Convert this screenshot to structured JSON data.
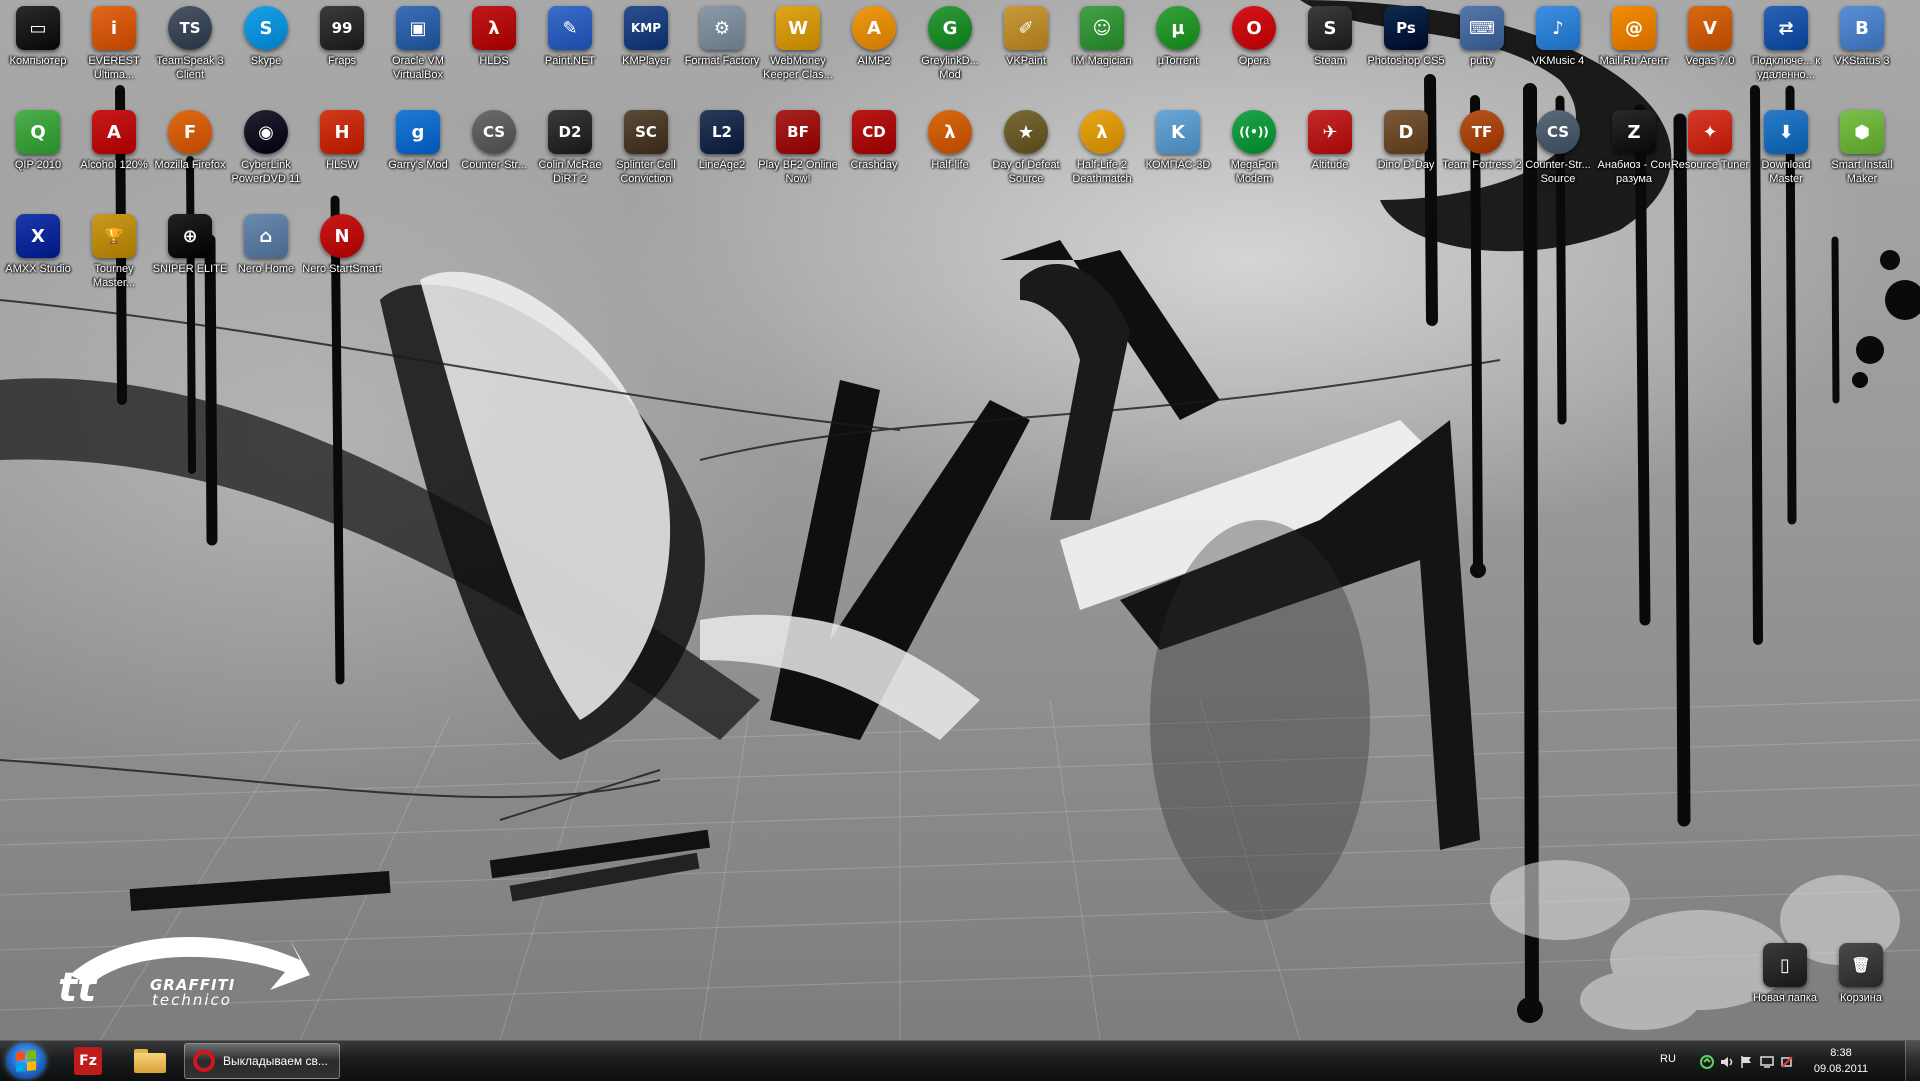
{
  "desktop": {
    "icons": [
      {
        "id": "computer",
        "label": "Компьютер",
        "icon": "computer-monitor-icon",
        "color": "#2a2a2a",
        "glyph": "▭"
      },
      {
        "id": "everest",
        "label": "EVEREST Ultima...",
        "icon": "everest-info-icon",
        "color": "#e0671b",
        "glyph": "i"
      },
      {
        "id": "teamspeak",
        "label": "TeamSpeak 3 Client",
        "icon": "teamspeak-icon",
        "color": "#4a5566",
        "glyph": "TS"
      },
      {
        "id": "skype",
        "label": "Skype",
        "icon": "skype-icon",
        "color": "#1aa0e8",
        "glyph": "S"
      },
      {
        "id": "fraps",
        "label": "Fraps",
        "icon": "fraps-icon",
        "color": "#3b3b3b",
        "glyph": "99"
      },
      {
        "id": "virtualbox",
        "label": "Oracle VM VirtualBox",
        "icon": "virtualbox-icon",
        "color": "#3d6fb5",
        "glyph": "▣"
      },
      {
        "id": "hlds",
        "label": "HLDS",
        "icon": "hlds-lambda-icon",
        "color": "#c0181a",
        "glyph": "λ"
      },
      {
        "id": "paintnet",
        "label": "Paint.NET",
        "icon": "paintnet-icon",
        "color": "#3b6dc9",
        "glyph": "✎"
      },
      {
        "id": "kmplayer",
        "label": "KMPlayer",
        "icon": "kmplayer-icon",
        "color": "#2c4f8d",
        "glyph": "KMP"
      },
      {
        "id": "formatfactory",
        "label": "Format Factory",
        "icon": "format-factory-icon",
        "color": "#8a9aa8",
        "glyph": "⚙"
      },
      {
        "id": "webmoney",
        "label": "WebMoney Keeper Clas...",
        "icon": "webmoney-icon",
        "color": "#e0a51c",
        "glyph": "W"
      },
      {
        "id": "aimp2",
        "label": "AIMP2",
        "icon": "aimp-icon",
        "color": "#f09a14",
        "glyph": "A"
      },
      {
        "id": "greylink",
        "label": "GreylinkD... Mod",
        "icon": "greylink-icon",
        "color": "#2e9a3a",
        "glyph": "G"
      },
      {
        "id": "vkpaint",
        "label": "VKPaint",
        "icon": "vkpaint-icon",
        "color": "#c99a3c",
        "glyph": "✐"
      },
      {
        "id": "immagician",
        "label": "IM Magician",
        "icon": "im-magician-icon",
        "color": "#45a148",
        "glyph": "☺"
      },
      {
        "id": "utorrent",
        "label": "µTorrent",
        "icon": "utorrent-icon",
        "color": "#35a23b",
        "glyph": "µ"
      },
      {
        "id": "opera",
        "label": "Opera",
        "icon": "opera-icon",
        "color": "#d5151d",
        "glyph": "O"
      },
      {
        "id": "steam",
        "label": "Steam",
        "icon": "steam-icon",
        "color": "#3c3c3c",
        "glyph": "S"
      },
      {
        "id": "photoshop",
        "label": "Photoshop CS5",
        "icon": "photoshop-icon",
        "color": "#0d2b4d",
        "glyph": "Ps"
      },
      {
        "id": "putty",
        "label": "putty",
        "icon": "putty-icon",
        "color": "#5577aa",
        "glyph": "⌨"
      },
      {
        "id": "vkmusic",
        "label": "VKMusic 4",
        "icon": "vkmusic-icon",
        "color": "#3f8fe0",
        "glyph": "♪"
      },
      {
        "id": "mailru",
        "label": "Mail.Ru Агент",
        "icon": "mailru-agent-icon",
        "color": "#f28d00",
        "glyph": "@"
      },
      {
        "id": "vegas",
        "label": "Vegas 7.0",
        "icon": "vegas-icon",
        "color": "#d86a13",
        "glyph": "V"
      },
      {
        "id": "rdp",
        "label": "Подключе... к удаленно...",
        "icon": "remote-desktop-icon",
        "color": "#2a62b5",
        "glyph": "⇄"
      },
      {
        "id": "vkstatus",
        "label": "VKStatus 3",
        "icon": "vkstatus-icon",
        "color": "#5a8fd6",
        "glyph": "B"
      },
      {
        "id": "qip",
        "label": "QIP 2010",
        "icon": "qip-icon",
        "color": "#4bb04b",
        "glyph": "Q"
      },
      {
        "id": "alcohol",
        "label": "Alcohol 120%",
        "icon": "alcohol-icon",
        "color": "#c81a1a",
        "glyph": "A"
      },
      {
        "id": "firefox",
        "label": "Mozilla Firefox",
        "icon": "firefox-icon",
        "color": "#e06b14",
        "glyph": "F"
      },
      {
        "id": "powerdvd",
        "label": "CyberLink PowerDVD 11",
        "icon": "powerdvd-icon",
        "color": "#222233",
        "glyph": "◉"
      },
      {
        "id": "hlsw",
        "label": "HLSW",
        "icon": "hlsw-icon",
        "color": "#d23a1b",
        "glyph": "H"
      },
      {
        "id": "garrysmod",
        "label": "Garry's Mod",
        "icon": "garrys-mod-icon",
        "color": "#1f7ad6",
        "glyph": "g"
      },
      {
        "id": "counterstrike",
        "label": "Counter-Str...",
        "icon": "counter-strike-icon",
        "color": "#6b6b6b",
        "glyph": "CS"
      },
      {
        "id": "dirt2",
        "label": "Colin McRae DiRT 2",
        "icon": "dirt2-icon",
        "color": "#3a3a3a",
        "glyph": "D2"
      },
      {
        "id": "splintercell",
        "label": "Splinter Cell Conviction",
        "icon": "splinter-cell-icon",
        "color": "#5a4a3a",
        "glyph": "SC"
      },
      {
        "id": "lineage2",
        "label": "LineAge2",
        "icon": "lineage2-icon",
        "color": "#2a3a5a",
        "glyph": "L2"
      },
      {
        "id": "battlefield",
        "label": "Play BF2 Online Now!",
        "icon": "battlefield-icon",
        "color": "#aa2222",
        "glyph": "BF"
      },
      {
        "id": "crashday",
        "label": "Crashday",
        "icon": "crashday-icon",
        "color": "#b81818",
        "glyph": "CD"
      },
      {
        "id": "halflife",
        "label": "Half-life",
        "icon": "half-life-icon",
        "color": "#d96a10",
        "glyph": "λ"
      },
      {
        "id": "dods",
        "label": "Day of Defeat Source",
        "icon": "day-of-defeat-icon",
        "color": "#7a6a3a",
        "glyph": "★"
      },
      {
        "id": "hl2dm",
        "label": "Half-Life 2 Deathmatch",
        "icon": "hl2-deathmatch-icon",
        "color": "#e8a617",
        "glyph": "λ"
      },
      {
        "id": "kompas",
        "label": "КОМПАС-3D",
        "icon": "kompas-3d-icon",
        "color": "#6aa6d6",
        "glyph": "K"
      },
      {
        "id": "megafon",
        "label": "MegaFon Modem",
        "icon": "megafon-modem-icon",
        "color": "#1fa54a",
        "glyph": "((•))"
      },
      {
        "id": "altitude",
        "label": "Altitude",
        "icon": "altitude-icon",
        "color": "#c42a2a",
        "glyph": "✈"
      },
      {
        "id": "dinodday",
        "label": "Dino D-Day",
        "icon": "dino-dday-icon",
        "color": "#7a5a3a",
        "glyph": "D"
      },
      {
        "id": "tf2",
        "label": "Team Fortress 2",
        "icon": "team-fortress-icon",
        "color": "#b5541c",
        "glyph": "TF"
      },
      {
        "id": "cssource",
        "label": "Counter-Str... Source",
        "icon": "cs-source-icon",
        "color": "#5a6a7a",
        "glyph": "CS"
      },
      {
        "id": "anabiosis",
        "label": "Анабиоз - Сон разума",
        "icon": "anabiosis-icon",
        "color": "#2a2a2a",
        "glyph": "Z"
      },
      {
        "id": "resourcetuner",
        "label": "Resource Tuner",
        "icon": "resource-tuner-icon",
        "color": "#d83a2a",
        "glyph": "✦"
      },
      {
        "id": "downloadmaster",
        "label": "Download Master",
        "icon": "download-master-icon",
        "color": "#2a7bc8",
        "glyph": "⬇"
      },
      {
        "id": "smartinstall",
        "label": "Smart Install Maker",
        "icon": "smart-install-icon",
        "color": "#7ac04a",
        "glyph": "⬢"
      },
      {
        "id": "amxx",
        "label": "AMXX Studio",
        "icon": "amxx-studio-icon",
        "color": "#1a3aa8",
        "glyph": "X"
      },
      {
        "id": "tourney",
        "label": "Tourney Master...",
        "icon": "trophy-icon",
        "color": "#c99a1c",
        "glyph": "🏆"
      },
      {
        "id": "sniperelite",
        "label": "SNIPER ELITE",
        "icon": "crosshair-icon",
        "color": "#222222",
        "glyph": "⊕"
      },
      {
        "id": "nerohome",
        "label": "Nero Home",
        "icon": "nero-home-icon",
        "color": "#6a8ab0",
        "glyph": "⌂"
      },
      {
        "id": "nerostart",
        "label": "Nero StartSmart",
        "icon": "nero-startsmart-icon",
        "color": "#c81a1a",
        "glyph": "N"
      },
      {
        "id": "newfolder",
        "label": "Новая папка",
        "icon": "folder-icon",
        "color": "#3a3a3a",
        "glyph": "▯"
      },
      {
        "id": "recyclebin",
        "label": "Корзина",
        "icon": "recycle-bin-icon",
        "color": "#4a4a4a",
        "glyph": "🗑"
      }
    ]
  },
  "wallpaper": {
    "logo_line1": "GRAFFITI",
    "logo_line2": "technico",
    "logo_mark": "tt"
  },
  "taskbar": {
    "start_label": "Start",
    "pinned": [
      {
        "id": "filezilla",
        "icon": "filezilla-icon",
        "color": "#bf1b1b",
        "glyph": "Fz"
      },
      {
        "id": "explorer",
        "icon": "folder-explorer-icon",
        "color": "#e2b54a",
        "glyph": "▭"
      }
    ],
    "active_task": {
      "label": "Выкладываем св...",
      "icon": "opera-icon",
      "color": "#d5151d"
    },
    "tray": {
      "language": "RU",
      "icons": [
        "network-icon",
        "volume-icon",
        "action-center-flag-icon",
        "display-icon",
        "power-icon"
      ],
      "time": "8:38",
      "date": "09.08.2011"
    }
  },
  "colors": {
    "taskbar_top": "#3a3a3c",
    "taskbar_bottom": "#0d0e10",
    "start_orb": "#1e67c8"
  }
}
